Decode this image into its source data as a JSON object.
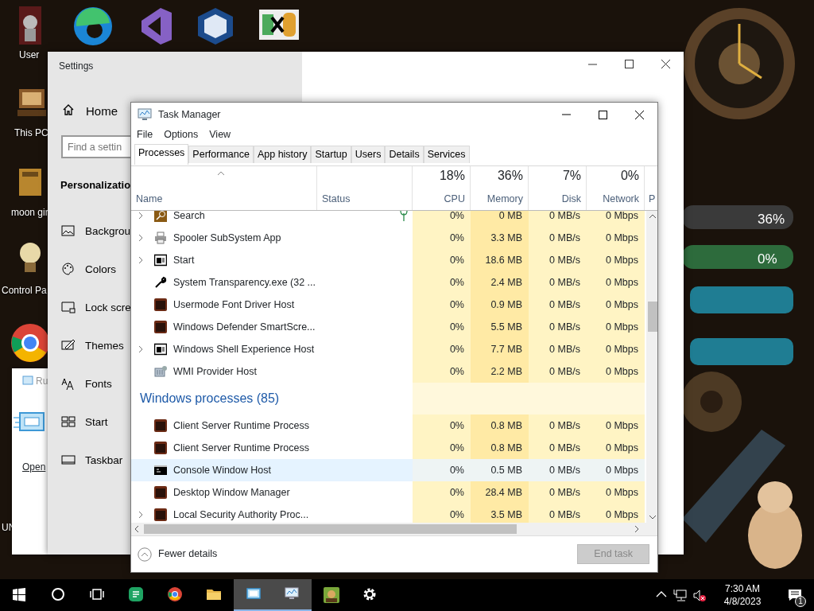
{
  "desktop": {
    "labels": [
      "User",
      "This PC",
      "moon gir",
      "Control Pa",
      "UN"
    ]
  },
  "run_dialog": {
    "title": "Ru",
    "open_label": "Open"
  },
  "meters": [
    {
      "reading": "36%"
    },
    {
      "reading": "0%"
    }
  ],
  "settings": {
    "title": "Settings",
    "home": "Home",
    "search_placeholder": "Find a settin",
    "section": "Personalizatio",
    "items": [
      "Backgrou",
      "Colors",
      "Lock scre",
      "Themes",
      "Fonts",
      "Start",
      "Taskbar"
    ]
  },
  "task_manager": {
    "title": "Task Manager",
    "menu": [
      "File",
      "Options",
      "View"
    ],
    "tabs": [
      {
        "label": "Processes",
        "selected": true
      },
      {
        "label": "Performance",
        "selected": false
      },
      {
        "label": "App history",
        "selected": false
      },
      {
        "label": "Startup",
        "selected": false
      },
      {
        "label": "Users",
        "selected": false
      },
      {
        "label": "Details",
        "selected": false
      },
      {
        "label": "Services",
        "selected": false
      }
    ],
    "columns": [
      {
        "label": "Name"
      },
      {
        "label": "Status"
      },
      {
        "label": "CPU",
        "usage": "18%"
      },
      {
        "label": "Memory",
        "usage": "36%"
      },
      {
        "label": "Disk",
        "usage": "7%"
      },
      {
        "label": "Network",
        "usage": "0%"
      },
      {
        "label": "P"
      }
    ],
    "rows": [
      {
        "kind": "process",
        "name": "Search",
        "expandable": true,
        "cpu": "0%",
        "memory": "0 MB",
        "disk": "0 MB/s",
        "network": "0 Mbps",
        "selected": false
      },
      {
        "kind": "process",
        "name": "Spooler SubSystem App",
        "expandable": true,
        "cpu": "0%",
        "memory": "3.3 MB",
        "disk": "0 MB/s",
        "network": "0 Mbps",
        "selected": false
      },
      {
        "kind": "process",
        "name": "Start",
        "expandable": true,
        "cpu": "0%",
        "memory": "18.6 MB",
        "disk": "0 MB/s",
        "network": "0 Mbps",
        "selected": false
      },
      {
        "kind": "process",
        "name": "System Transparency.exe (32 ...",
        "expandable": false,
        "cpu": "0%",
        "memory": "2.4 MB",
        "disk": "0 MB/s",
        "network": "0 Mbps",
        "selected": false
      },
      {
        "kind": "process",
        "name": "Usermode Font Driver Host",
        "expandable": false,
        "cpu": "0%",
        "memory": "0.9 MB",
        "disk": "0 MB/s",
        "network": "0 Mbps",
        "selected": false
      },
      {
        "kind": "process",
        "name": "Windows Defender SmartScre...",
        "expandable": false,
        "cpu": "0%",
        "memory": "5.5 MB",
        "disk": "0 MB/s",
        "network": "0 Mbps",
        "selected": false
      },
      {
        "kind": "process",
        "name": "Windows Shell Experience Host",
        "expandable": true,
        "cpu": "0%",
        "memory": "7.7 MB",
        "disk": "0 MB/s",
        "network": "0 Mbps",
        "selected": false
      },
      {
        "kind": "process",
        "name": "WMI Provider Host",
        "expandable": false,
        "cpu": "0%",
        "memory": "2.2 MB",
        "disk": "0 MB/s",
        "network": "0 Mbps",
        "selected": false
      },
      {
        "kind": "group",
        "name": "Windows processes (85)"
      },
      {
        "kind": "process",
        "name": "Client Server Runtime Process",
        "expandable": false,
        "cpu": "0%",
        "memory": "0.8 MB",
        "disk": "0 MB/s",
        "network": "0 Mbps",
        "selected": false
      },
      {
        "kind": "process",
        "name": "Client Server Runtime Process",
        "expandable": false,
        "cpu": "0%",
        "memory": "0.8 MB",
        "disk": "0 MB/s",
        "network": "0 Mbps",
        "selected": false
      },
      {
        "kind": "process",
        "name": "Console Window Host",
        "expandable": false,
        "cpu": "0%",
        "memory": "0.5 MB",
        "disk": "0 MB/s",
        "network": "0 Mbps",
        "selected": true
      },
      {
        "kind": "process",
        "name": "Desktop Window Manager",
        "expandable": false,
        "cpu": "0%",
        "memory": "28.4 MB",
        "disk": "0 MB/s",
        "network": "0 Mbps",
        "selected": false
      },
      {
        "kind": "process",
        "name": "Local Security Authority Proc...",
        "expandable": true,
        "cpu": "0%",
        "memory": "3.5 MB",
        "disk": "0 MB/s",
        "network": "0 Mbps",
        "selected": false
      }
    ],
    "fewer_details": "Fewer details",
    "end_task": {
      "label": "End task",
      "disabled": true
    }
  },
  "taskbar": {
    "apps": [
      {
        "active": false
      },
      {
        "active": false
      },
      {
        "active": false
      },
      {
        "active": false
      },
      {
        "active": false
      },
      {
        "active": false
      },
      {
        "active": true
      },
      {
        "active": true
      },
      {
        "active": false
      },
      {
        "active": false
      }
    ],
    "time": "7:30 AM",
    "date": "4/8/2023",
    "notifications": "1"
  }
}
